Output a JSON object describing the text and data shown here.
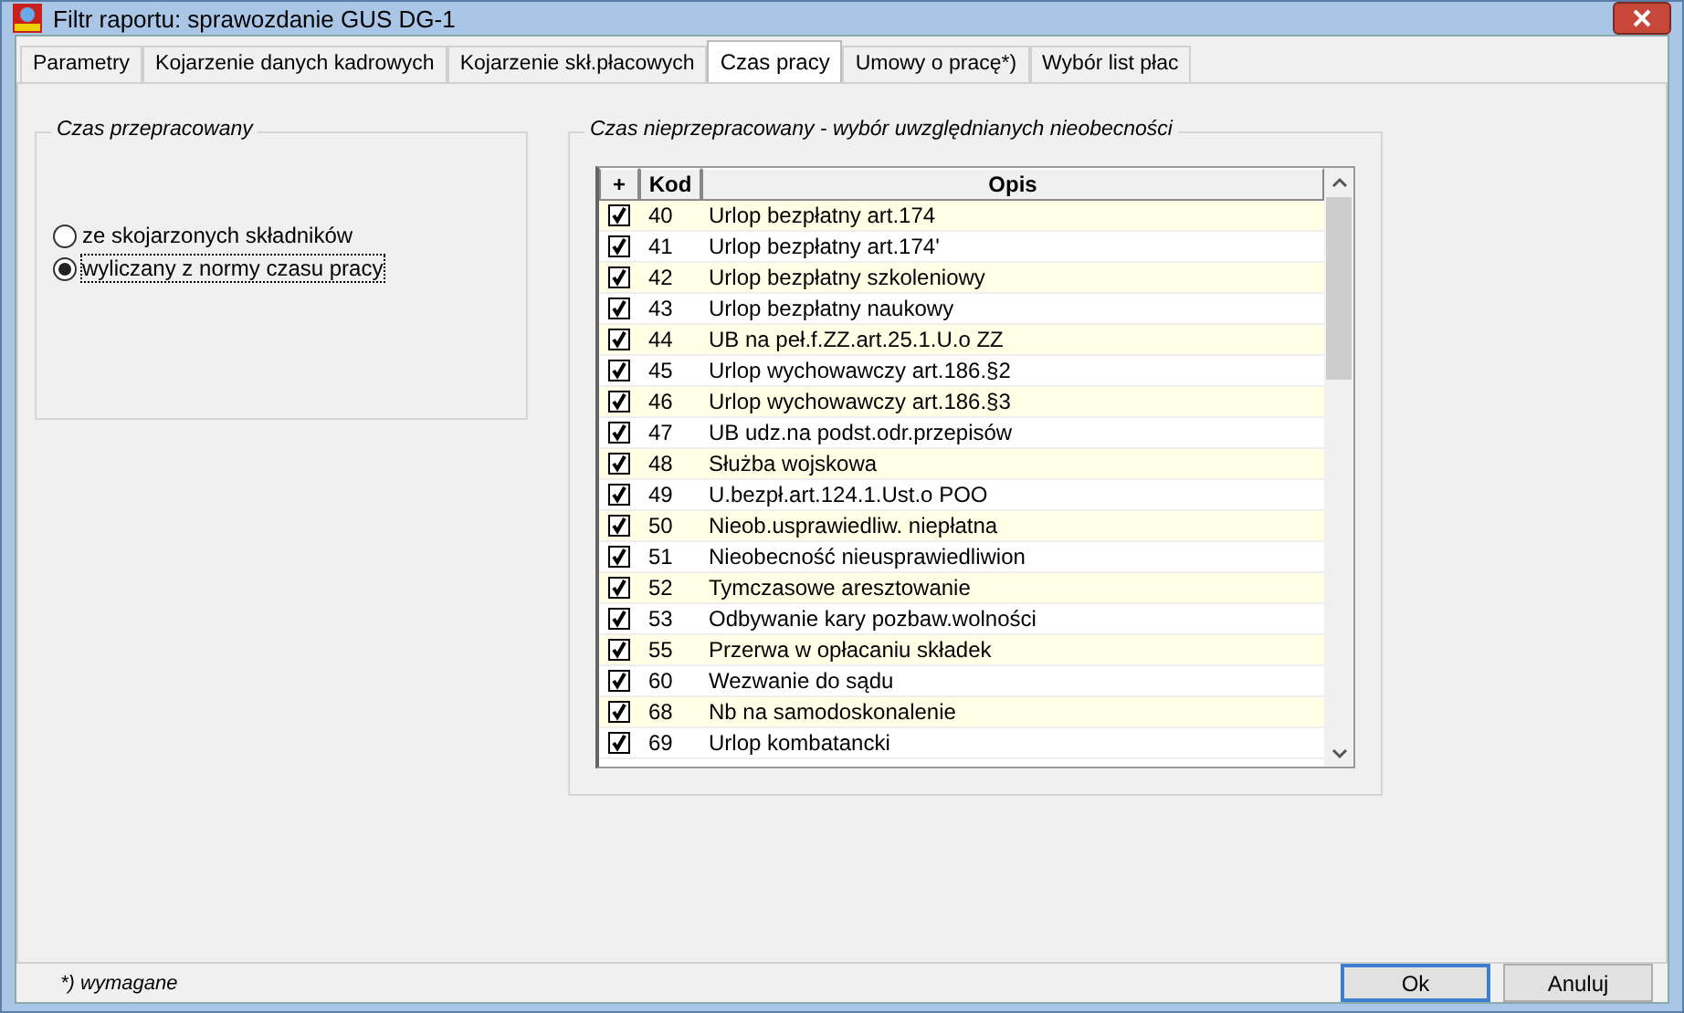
{
  "window": {
    "title": "Filtr raportu: sprawozdanie GUS DG-1"
  },
  "tabs": [
    {
      "label": "Parametry",
      "selected": false
    },
    {
      "label": "Kojarzenie danych kadrowych",
      "selected": false
    },
    {
      "label": "Kojarzenie skł.płacowych",
      "selected": false
    },
    {
      "label": "Czas pracy",
      "selected": true
    },
    {
      "label": "Umowy o pracę*)",
      "selected": false
    },
    {
      "label": "Wybór list płac",
      "selected": false
    }
  ],
  "worked_time": {
    "title": "Czas przepracowany",
    "options": [
      {
        "label": "ze skojarzonych składników",
        "selected": false
      },
      {
        "label": "wyliczany z normy czasu pracy",
        "selected": true
      }
    ]
  },
  "absences": {
    "title": "Czas nieprzepracowany - wybór uwzględnianych nieobecności",
    "columns": [
      "+",
      "Kod",
      "Opis"
    ],
    "rows": [
      {
        "checked": true,
        "code": "40",
        "description": "Urlop bezpłatny art.174"
      },
      {
        "checked": true,
        "code": "41",
        "description": "Urlop bezpłatny art.174'"
      },
      {
        "checked": true,
        "code": "42",
        "description": "Urlop bezpłatny szkoleniowy"
      },
      {
        "checked": true,
        "code": "43",
        "description": "Urlop bezpłatny naukowy"
      },
      {
        "checked": true,
        "code": "44",
        "description": "UB na peł.f.ZZ.art.25.1.U.o ZZ"
      },
      {
        "checked": true,
        "code": "45",
        "description": "Urlop wychowawczy art.186.§2"
      },
      {
        "checked": true,
        "code": "46",
        "description": "Urlop wychowawczy art.186.§3"
      },
      {
        "checked": true,
        "code": "47",
        "description": "UB udz.na podst.odr.przepisów"
      },
      {
        "checked": true,
        "code": "48",
        "description": "Służba wojskowa"
      },
      {
        "checked": true,
        "code": "49",
        "description": "U.bezpł.art.124.1.Ust.o POO"
      },
      {
        "checked": true,
        "code": "50",
        "description": "Nieob.usprawiedliw. niepłatna"
      },
      {
        "checked": true,
        "code": "51",
        "description": "Nieobecność nieusprawiedliwion"
      },
      {
        "checked": true,
        "code": "52",
        "description": "Tymczasowe aresztowanie"
      },
      {
        "checked": true,
        "code": "53",
        "description": "Odbywanie kary pozbaw.wolności"
      },
      {
        "checked": true,
        "code": "55",
        "description": "Przerwa w opłacaniu składek"
      },
      {
        "checked": true,
        "code": "60",
        "description": "Wezwanie do sądu"
      },
      {
        "checked": true,
        "code": "68",
        "description": "Nb na samodoskonalenie"
      },
      {
        "checked": true,
        "code": "69",
        "description": "Urlop kombatancki"
      }
    ]
  },
  "footer": {
    "note": "*) wymagane",
    "buttons": [
      "Ok",
      "Anuluj"
    ]
  }
}
